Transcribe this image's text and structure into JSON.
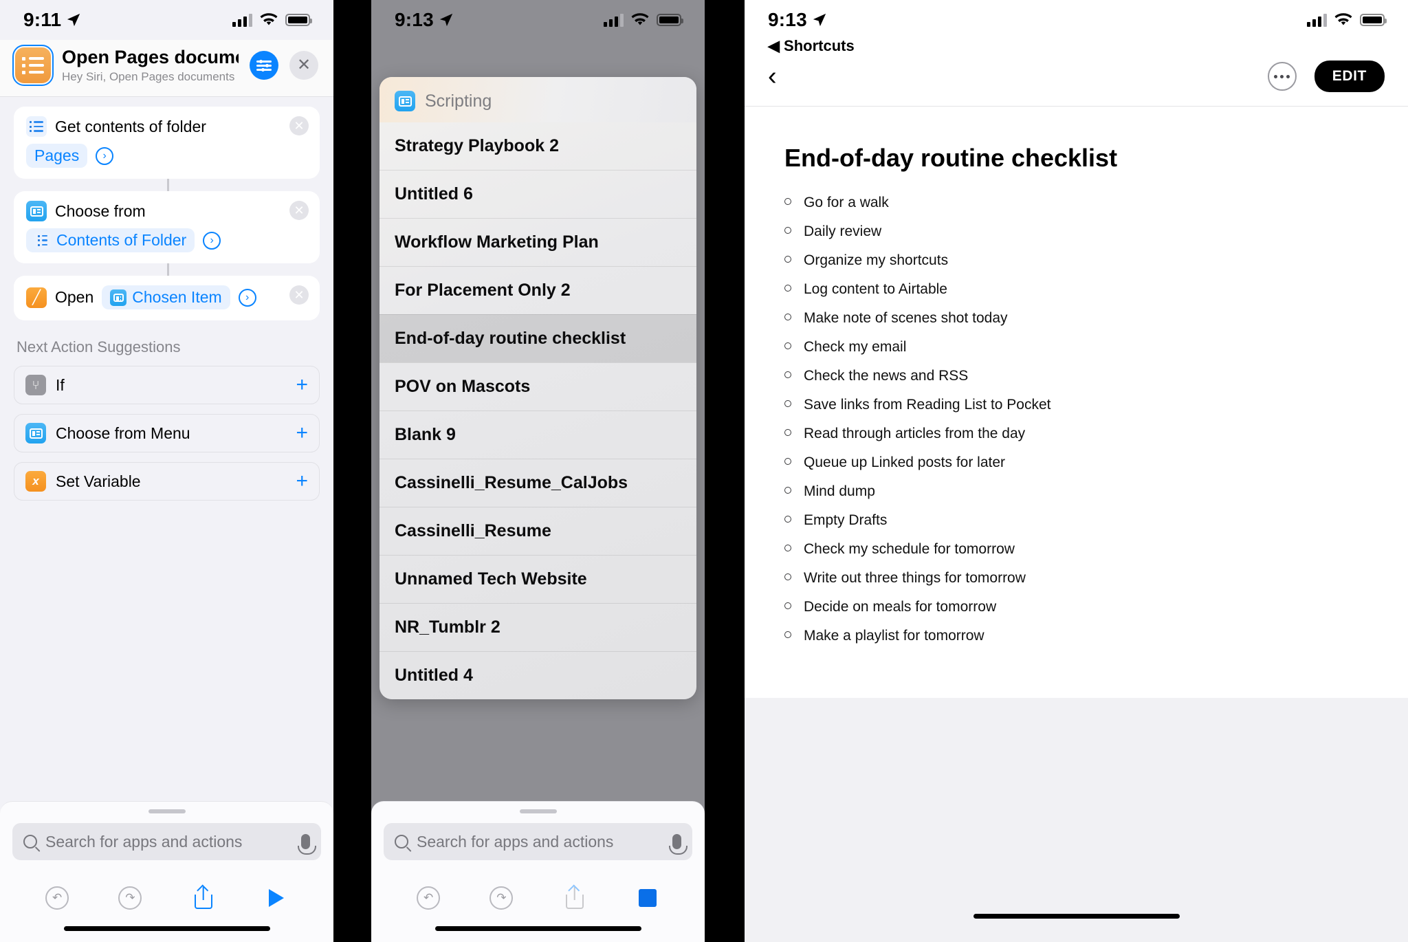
{
  "left_panel": {
    "status": {
      "time": "9:11",
      "location_icon": "location-arrow-icon"
    },
    "header": {
      "shortcut_icon": "list-bullet-icon",
      "title": "Open Pages docume...",
      "subtitle": "Hey Siri, Open Pages documents",
      "settings_icon": "sliders-icon",
      "close_icon": "close-icon"
    },
    "actions": [
      {
        "icon": "list-bullet-icon",
        "title": "Get contents of folder",
        "token": "Pages",
        "token_icon": null,
        "disclosure_icon": "chevron-right-circle-icon",
        "delete_icon": "remove-circle-icon"
      },
      {
        "icon": "choose-from-list-icon",
        "title": "Choose from",
        "token": "Contents of Folder",
        "token_icon": "list-bullet-icon",
        "disclosure_icon": "chevron-right-circle-icon",
        "delete_icon": "remove-circle-icon"
      },
      {
        "icon": "pages-app-icon",
        "title": "Open",
        "token": "Chosen Item",
        "token_icon": "choose-from-list-icon",
        "disclosure_icon": "chevron-right-circle-icon",
        "delete_icon": "remove-circle-icon"
      }
    ],
    "suggestions_label": "Next Action Suggestions",
    "suggestions": [
      {
        "icon": "if-branch-icon",
        "label": "If",
        "add_icon": "plus-icon"
      },
      {
        "icon": "choose-menu-icon",
        "label": "Choose from Menu",
        "add_icon": "plus-icon"
      },
      {
        "icon": "set-variable-icon",
        "label": "Set Variable",
        "add_icon": "plus-icon"
      }
    ],
    "dock": {
      "search_placeholder": "Search for apps and actions",
      "search_icon": "search-icon",
      "mic_icon": "microphone-icon",
      "undo_icon": "undo-icon",
      "redo_icon": "redo-icon",
      "share_icon": "share-icon",
      "run_icon": "play-icon"
    }
  },
  "middle_panel": {
    "status": {
      "time": "9:13",
      "location_icon": "location-arrow-icon"
    },
    "sheet": {
      "header_icon": "choose-from-list-icon",
      "header_title": "Scripting",
      "items": [
        "Strategy Playbook 2",
        "Untitled 6",
        "Workflow Marketing Plan",
        "For Placement Only 2",
        "End-of-day routine checklist",
        "POV on Mascots",
        "Blank 9",
        "Cassinelli_Resume_CalJobs",
        "Cassinelli_Resume",
        "Unnamed Tech Website",
        "NR_Tumblr 2",
        "Untitled 4"
      ],
      "selected_item": "End-of-day routine checklist"
    },
    "dock": {
      "search_placeholder": "Search for apps and actions",
      "search_icon": "search-icon",
      "mic_icon": "microphone-icon",
      "undo_icon": "undo-icon",
      "redo_icon": "redo-icon",
      "share_icon": "share-icon",
      "stop_icon": "stop-icon"
    }
  },
  "right_panel": {
    "status": {
      "time": "9:13",
      "location_icon": "location-arrow-icon"
    },
    "back_to_app": "◀ Shortcuts",
    "nav": {
      "back_icon": "chevron-left-icon",
      "more_icon": "ellipsis-circle-icon",
      "edit_label": "EDIT"
    },
    "document": {
      "title": "End-of-day routine checklist",
      "items": [
        "Go for a walk",
        "Daily review",
        "Organize my shortcuts",
        "Log content to Airtable",
        "Make note of scenes shot today",
        "Check my email",
        "Check the news and RSS",
        "Save links from Reading List to Pocket",
        "Read through articles from the day",
        "Queue up Linked posts for later",
        "Mind dump",
        "Empty Drafts",
        "Check my schedule for tomorrow",
        "Write out three things for tomorrow",
        "Decide on meals for tomorrow",
        "Make a playlist for tomorrow"
      ]
    }
  },
  "colors": {
    "accent_blue": "#0a84ff",
    "shortcut_orange": "#f09a3e",
    "panel_bg": "#f2f2f7",
    "sheet_bg": "#e9e9eb"
  }
}
